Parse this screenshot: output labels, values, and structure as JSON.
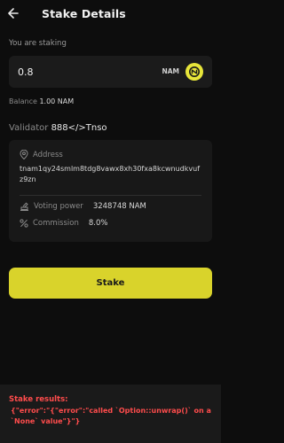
{
  "header": {
    "title": "Stake Details",
    "back_icon": "arrow-left-icon"
  },
  "staking": {
    "label": "You are staking",
    "amount": "0.8",
    "token": "NAM",
    "token_icon": "namada-logo-icon",
    "token_color": "#e7e53a"
  },
  "balance": {
    "label": "Balance",
    "value": "1.00 NAM"
  },
  "validator": {
    "label": "Validator",
    "name": "888</>Tnso"
  },
  "details": {
    "address_label": "Address",
    "address_value": "tnam1qy24smlm8tdg8vawx8xh30fxa8kcwnudkvufz9zn",
    "voting_power_label": "Voting power",
    "voting_power_value": "3248748 NAM",
    "commission_label": "Commission",
    "commission_value": "8.0%"
  },
  "actions": {
    "stake_label": "Stake",
    "accent_color": "#d9d32b"
  },
  "results": {
    "title": "Stake results:",
    "body": "{\"error\":\"{\"error\":\"called `Option::unwrap()` on a `None` value\"}\"}",
    "color": "#ff4c4c"
  }
}
